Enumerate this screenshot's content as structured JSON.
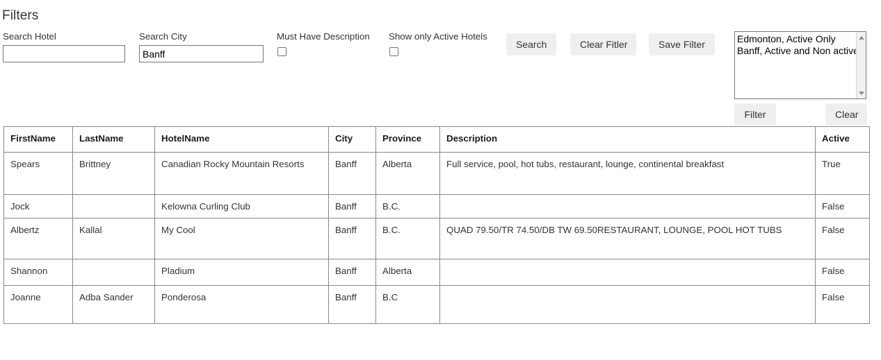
{
  "page": {
    "title": "Filters"
  },
  "filters": {
    "search_hotel": {
      "label": "Search Hotel",
      "value": "",
      "placeholder": ""
    },
    "search_city": {
      "label": "Search City",
      "value": "Banff",
      "placeholder": ""
    },
    "must_have_description": {
      "label": "Must Have Description",
      "checked": false
    },
    "show_only_active": {
      "label": "Show only Active Hotels",
      "checked": false
    }
  },
  "buttons": {
    "search": "Search",
    "clear_filter": "Clear Fitler",
    "save_filter": "Save Filter",
    "filter": "Filter",
    "clear": "Clear"
  },
  "saved_filters": {
    "options": [
      "Edmonton, Active Only",
      "Banff, Active and Non active"
    ],
    "selected": null,
    "scroll_up_icon": "caret-up-icon",
    "scroll_down_icon": "caret-down-icon"
  },
  "results": {
    "columns": [
      "FirstName",
      "LastName",
      "HotelName",
      "City",
      "Province",
      "Description",
      "Active"
    ],
    "rows": [
      {
        "FirstName": "Spears",
        "LastName": "Brittney",
        "HotelName": "Canadian Rocky Mountain Resorts",
        "City": "Banff",
        "Province": "Alberta",
        "Description": "Full service, pool, hot tubs, restaurant, lounge, continental breakfast",
        "Active": "True"
      },
      {
        "FirstName": "Jock",
        "LastName": "",
        "HotelName": "Kelowna Curling Club",
        "City": "Banff",
        "Province": "B.C.",
        "Description": "",
        "Active": "False"
      },
      {
        "FirstName": "Albertz",
        "LastName": "Kallal",
        "HotelName": "My Cool",
        "City": "Banff",
        "Province": "B.C.",
        "Description": "QUAD 79.50/TR 74.50/DB TW 69.50RESTAURANT, LOUNGE, POOL HOT TUBS",
        "Active": "False"
      },
      {
        "FirstName": "Shannon",
        "LastName": "",
        "HotelName": "Pladium",
        "City": "Banff",
        "Province": "Alberta",
        "Description": "",
        "Active": "False"
      },
      {
        "FirstName": "Joanne",
        "LastName": "Adba Sander",
        "HotelName": "Ponderosa",
        "City": "Banff",
        "Province": "B.C",
        "Description": "",
        "Active": "False"
      }
    ]
  },
  "colors": {
    "button_background": "#efefef",
    "table_border": "#888888",
    "input_border": "#767676",
    "text": "#333333"
  }
}
